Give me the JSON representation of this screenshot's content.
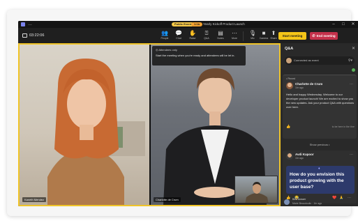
{
  "window": {
    "badge_primary": "Public Event",
    "badge_secondary": "1:1b",
    "title": "Yearly Kickoff Product Launch",
    "controls": [
      "–",
      "□",
      "✕"
    ]
  },
  "toolbar": {
    "timer": "03:22:06",
    "buttons": [
      {
        "icon": "people-icon",
        "glyph": "👥",
        "label": "People"
      },
      {
        "icon": "chat-icon",
        "glyph": "💬",
        "label": "Chat"
      },
      {
        "icon": "raise-hand-icon",
        "glyph": "✋",
        "label": "Raise"
      },
      {
        "icon": "qa-icon",
        "glyph": "⍰",
        "label": "Q&A"
      },
      {
        "icon": "notes-icon",
        "glyph": "▤",
        "label": "Notes"
      },
      {
        "icon": "more-icon",
        "glyph": "⋯",
        "label": "More"
      },
      {
        "icon": "mic-icon",
        "glyph": "🎙",
        "label": "Mic"
      },
      {
        "icon": "camera-icon",
        "glyph": "■",
        "label": "Camera"
      },
      {
        "icon": "share-icon",
        "glyph": "⬆",
        "label": "Share"
      }
    ],
    "start_label": "Start meeting",
    "end_label": "End meeting"
  },
  "stage": {
    "left_name": "Kaneth Mendez",
    "right_name": "Charlotte de Crum",
    "overlay_head": "Attendees only",
    "overlay_body": "Start the meeting when you're ready and attendees will be let in."
  },
  "qa": {
    "title": "Q&A",
    "ask_placeholder": "Connected as event",
    "filter_icon": "filter-icon",
    "pinned_label": "• Pinned",
    "card1": {
      "author": "Charlotte de Crum",
      "time": "1hr ago",
      "body": "Hello and happy Wednesday. Welcome to our developer product launch! We are excited to show you the new updates. Ask your product Q&A with questions over here.",
      "reply_hint": "to be here in the thre"
    },
    "show_more": "Show previous •",
    "card2": {
      "author": "Avdi Kapoor",
      "time": "1hr ago",
      "question": "How do you envision this product growing with the user base?"
    },
    "reactions": [
      "👍",
      "😂",
      "❤️",
      "🙏"
    ],
    "bottom": {
      "line1": "Best answer",
      "line2": "Marie Beaudoulin · 1hr ago"
    }
  },
  "colors": {
    "accent_yellow": "#f0c428",
    "end_red": "#c4314b",
    "highlight_blue": "#2d3a6b"
  }
}
